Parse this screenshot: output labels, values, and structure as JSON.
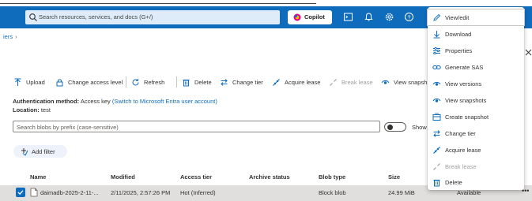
{
  "search": {
    "placeholder": "Search resources, services, and docs (G+/)"
  },
  "copilot": {
    "label": "Copilot"
  },
  "breadcrumb": {
    "text": "iers"
  },
  "toolbar": {
    "upload": "Upload",
    "change_access_level": "Change access level",
    "refresh": "Refresh",
    "delete": "Delete",
    "change_tier": "Change tier",
    "acquire_lease": "Acquire lease",
    "break_lease": "Break lease",
    "view_snapshots": "View snapsh"
  },
  "auth": {
    "label": "Authentication method:",
    "value": "Access key",
    "link": "(Switch to Microsoft Entra user account)",
    "location_label": "Location:",
    "location_value": "test"
  },
  "filter": {
    "prefix_placeholder": "Search blobs by prefix (case-sensitive)",
    "show_label": "Show",
    "add_filter": "Add filter"
  },
  "table": {
    "headers": [
      "Name",
      "Modified",
      "Access tier",
      "Archive status",
      "Blob type",
      "Size"
    ],
    "rows": [
      {
        "name": "daimadb-2025-2-11-...",
        "modified": "2/11/2025, 2:57:26 PM",
        "access_tier": "Hot (Inferred)",
        "archive_status": "",
        "blob_type": "Block blob",
        "size": "24.99 MiB",
        "lease_state": "Available",
        "more": "•••"
      }
    ]
  },
  "context_menu": {
    "items": [
      {
        "label": "View/edit",
        "icon": "pencil-icon",
        "enabled": true
      },
      {
        "label": "Download",
        "icon": "download-icon",
        "enabled": true
      },
      {
        "label": "Properties",
        "icon": "properties-icon",
        "enabled": true
      },
      {
        "label": "Generate SAS",
        "icon": "link-icon",
        "enabled": true
      },
      {
        "label": "View versions",
        "icon": "eye-icon",
        "enabled": true
      },
      {
        "label": "View snapshots",
        "icon": "eye-icon",
        "enabled": true
      },
      {
        "label": "Create snapshot",
        "icon": "snapshot-icon",
        "enabled": true
      },
      {
        "label": "Change tier",
        "icon": "swap-icon",
        "enabled": true
      },
      {
        "label": "Acquire lease",
        "icon": "lease-icon",
        "enabled": true
      },
      {
        "label": "Break lease",
        "icon": "break-lease-icon",
        "enabled": false
      },
      {
        "label": "Delete",
        "icon": "trash-icon",
        "enabled": true
      }
    ]
  },
  "colors": {
    "topbar": "#0f6cbd",
    "accent": "#0f6cbd",
    "selected_row": "#e1dfdd",
    "disabled_text": "#a19f9d"
  }
}
